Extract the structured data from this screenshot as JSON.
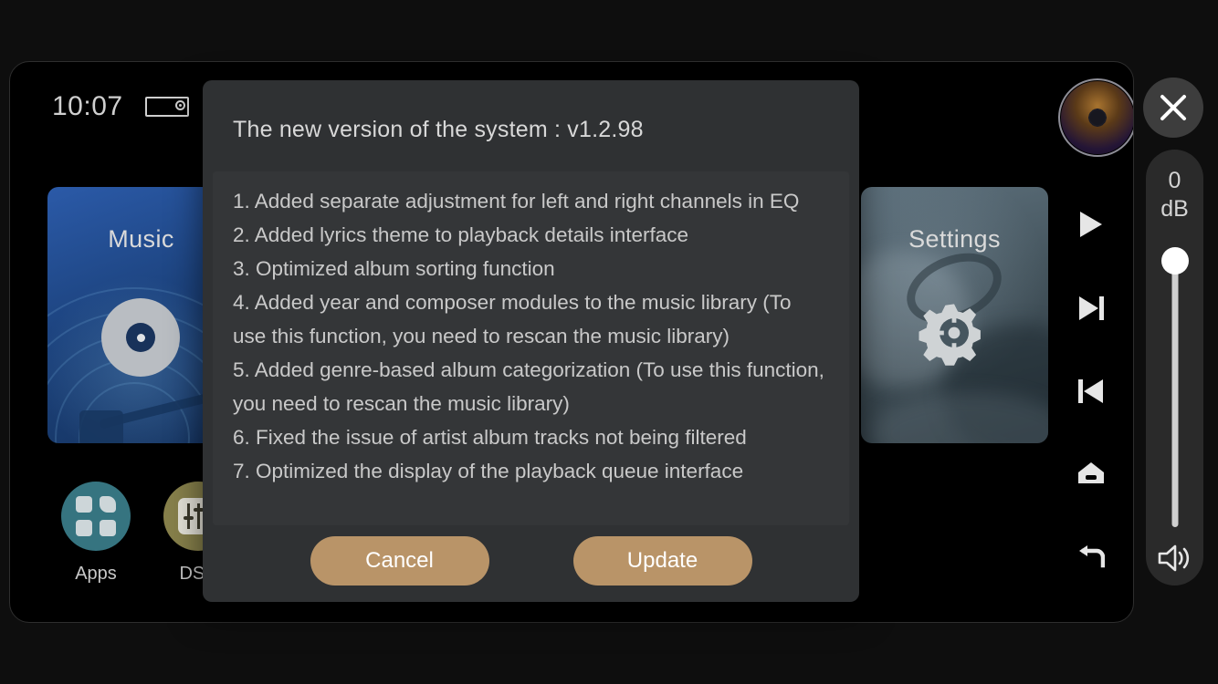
{
  "status_bar": {
    "clock": "10:07",
    "device_icon": "amplifier-icon"
  },
  "tiles": [
    {
      "label": "Music",
      "icon": "vinyl-record-icon"
    },
    {
      "label": "Settings",
      "icon": "gear-icon"
    }
  ],
  "shortcuts": [
    {
      "label": "Apps",
      "icon": "apps-grid-icon"
    },
    {
      "label": "DSP",
      "icon": "equalizer-sliders-icon"
    }
  ],
  "transport": {
    "album_art": "album-art-disc",
    "buttons": [
      {
        "name": "play",
        "icon": "play-icon"
      },
      {
        "name": "next",
        "icon": "next-track-icon"
      },
      {
        "name": "previous",
        "icon": "previous-track-icon"
      },
      {
        "name": "home",
        "icon": "home-icon"
      },
      {
        "name": "back",
        "icon": "back-arrow-icon"
      }
    ]
  },
  "volume": {
    "value": "0",
    "unit": "dB",
    "speaker_icon": "speaker-waves-icon"
  },
  "close_button": {
    "icon": "close-icon"
  },
  "dialog": {
    "title": "The new version of the system :  v1.2.98",
    "changelog": [
      "1. Added separate adjustment for left and right channels in EQ",
      "2. Added lyrics theme to playback details interface",
      "3. Optimized album sorting function",
      "4. Added year and composer modules to the music library (To use this function, you need to rescan the music library)",
      "5. Added genre-based album categorization (To use this function, you need to rescan the music library)",
      "6. Fixed the issue of artist album tracks not being filtered",
      "7. Optimized the display of the playback queue interface"
    ],
    "cancel_label": "Cancel",
    "update_label": "Update"
  },
  "colors": {
    "accent_button": "#b99468",
    "dialog_bg": "#2f3133",
    "dialog_body_bg": "#343638",
    "music_tile": "#1d4480",
    "settings_tile": "#46565f",
    "apps_bubble": "#367480",
    "dsp_bubble": "#87804b"
  }
}
